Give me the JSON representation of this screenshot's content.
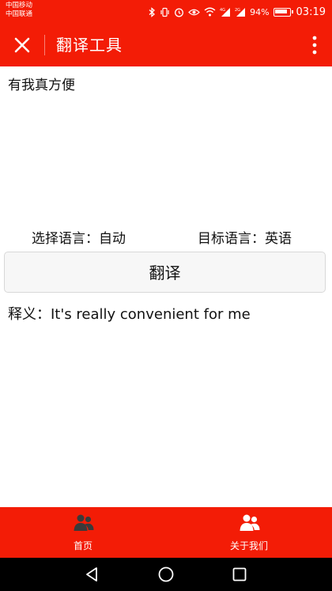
{
  "status_bar": {
    "carrier_1": "中国移动",
    "carrier_2": "中国联通",
    "battery": "94%",
    "time": "03:19",
    "icons": [
      "bluetooth-icon",
      "vibrate-icon",
      "alarm-icon",
      "eye-icon",
      "wifi-icon",
      "signal-4g-icon",
      "signal-2g-icon",
      "battery-icon"
    ]
  },
  "title_bar": {
    "title": "翻译工具",
    "close_icon": "close-icon",
    "more_icon": "more-vertical-icon"
  },
  "main": {
    "source_text": "有我真方便",
    "source_language": "选择语言：自动",
    "target_language": "目标语言：英语",
    "translate_button": "翻译",
    "result": "释义：It's really convenient for me"
  },
  "tab_bar": {
    "tabs": [
      {
        "label": "首页",
        "icon": "users-icon"
      },
      {
        "label": "关于我们",
        "icon": "users-icon"
      }
    ]
  },
  "nav_bar": {
    "icons": [
      "back-icon",
      "home-icon",
      "recents-icon"
    ]
  },
  "colors": {
    "accent": "#f31c06",
    "navbar": "#000000",
    "button_bg": "#f7f7f7"
  }
}
